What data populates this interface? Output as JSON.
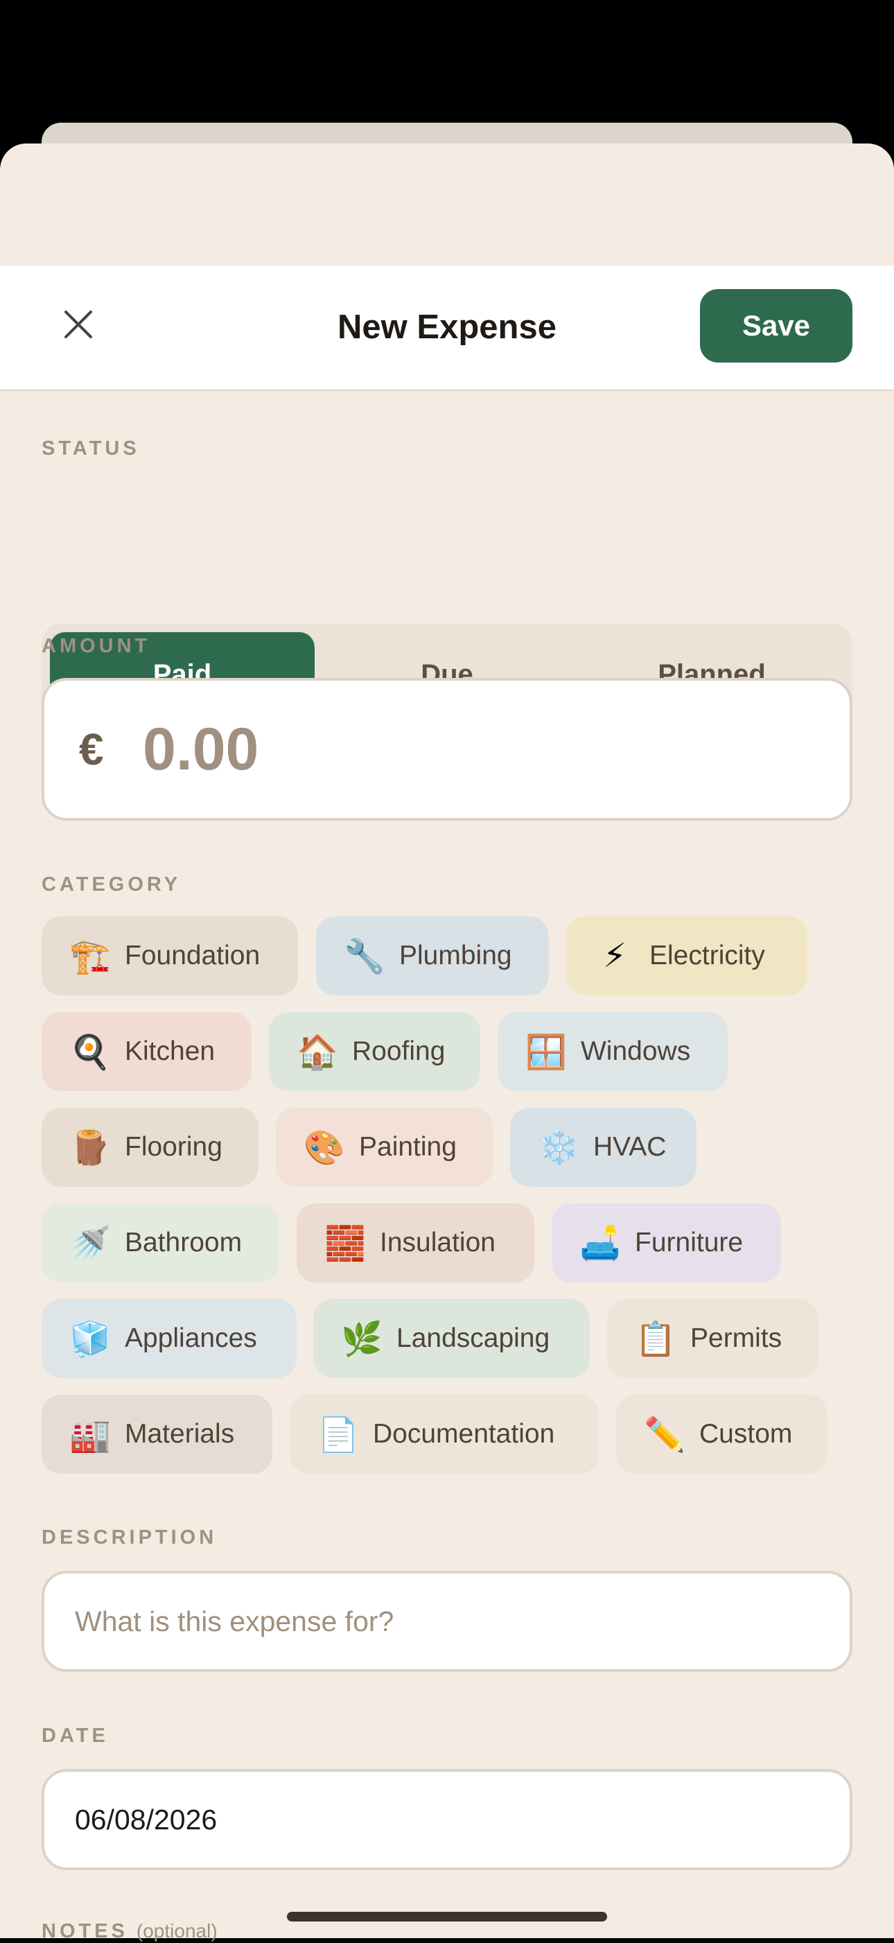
{
  "header": {
    "title": "New Expense",
    "save_label": "Save"
  },
  "status": {
    "label": "STATUS",
    "options": [
      "Paid",
      "Due",
      "Planned"
    ],
    "selected": "Paid"
  },
  "amount": {
    "label": "AMOUNT",
    "currency": "€",
    "value": "0.00"
  },
  "category": {
    "label": "CATEGORY",
    "items": [
      {
        "emoji": "🏗️",
        "label": "Foundation",
        "color": "#e7ddd0"
      },
      {
        "emoji": "🔧",
        "label": "Plumbing",
        "color": "#d8e1e6"
      },
      {
        "emoji": "⚡",
        "label": "Electricity",
        "color": "#f1e6c3"
      },
      {
        "emoji": "🍳",
        "label": "Kitchen",
        "color": "#f1dcd4"
      },
      {
        "emoji": "🏠",
        "label": "Roofing",
        "color": "#dde6dc"
      },
      {
        "emoji": "🪟",
        "label": "Windows",
        "color": "#dde5e7"
      },
      {
        "emoji": "🪵",
        "label": "Flooring",
        "color": "#e7ddd0"
      },
      {
        "emoji": "🎨",
        "label": "Painting",
        "color": "#f3e1d9"
      },
      {
        "emoji": "❄️",
        "label": "HVAC",
        "color": "#d8e1e6"
      },
      {
        "emoji": "🚿",
        "label": "Bathroom",
        "color": "#e3ebe0"
      },
      {
        "emoji": "🧱",
        "label": "Insulation",
        "color": "#ebdbd0"
      },
      {
        "emoji": "🛋️",
        "label": "Furniture",
        "color": "#e6e0ec"
      },
      {
        "emoji": "🧊",
        "label": "Appliances",
        "color": "#dde5e9"
      },
      {
        "emoji": "🌿",
        "label": "Landscaping",
        "color": "#dde6dc"
      },
      {
        "emoji": "📋",
        "label": "Permits",
        "color": "#eee5da"
      },
      {
        "emoji": "🏭",
        "label": "Materials",
        "color": "#e6dcd4"
      },
      {
        "emoji": "📄",
        "label": "Documentation",
        "color": "#eee5da"
      },
      {
        "emoji": "✏️",
        "label": "Custom",
        "color": "#eee5da"
      }
    ]
  },
  "description": {
    "label": "DESCRIPTION",
    "placeholder": "What is this expense for?",
    "value": ""
  },
  "date": {
    "label": "DATE",
    "value": "06/08/2026"
  },
  "notes": {
    "label": "NOTES",
    "optional": "(optional)"
  },
  "colors": {
    "accent": "#2e6a4e",
    "background": "#f4ece2",
    "label": "#a0907f"
  },
  "icons": {
    "close": "close-icon"
  }
}
